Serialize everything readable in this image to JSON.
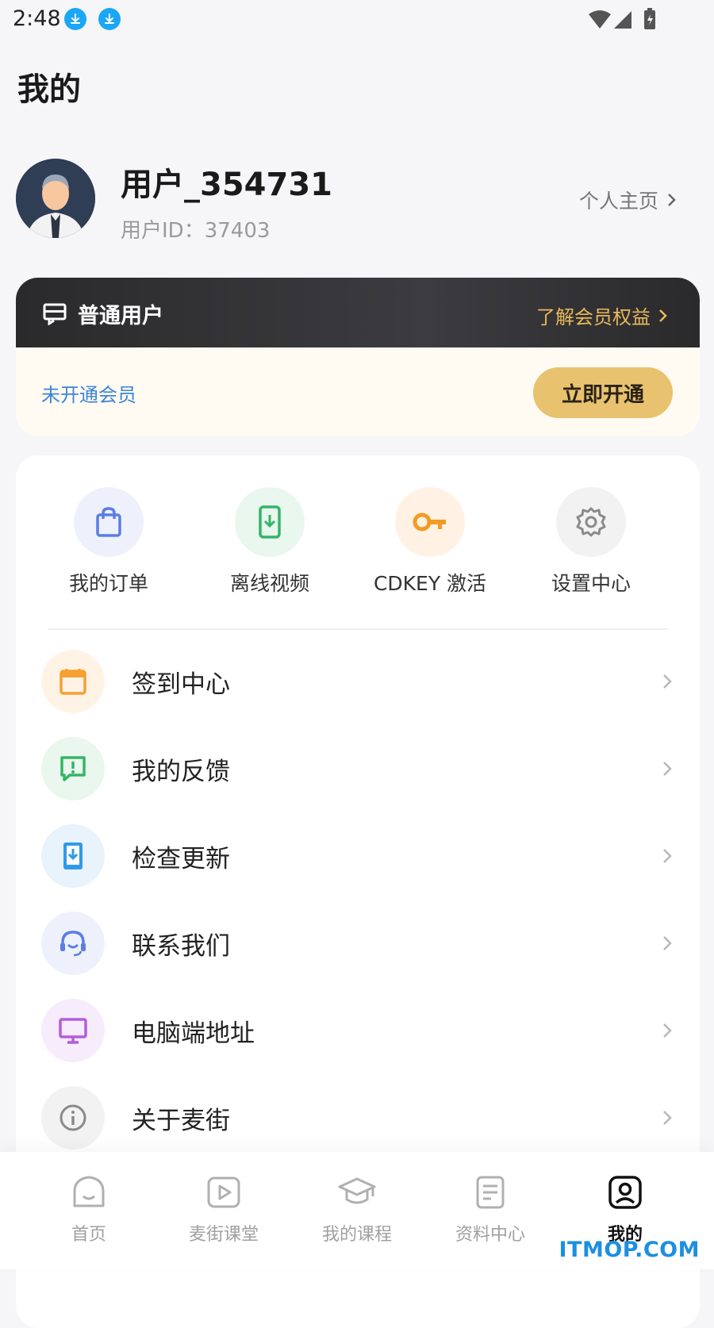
{
  "status_bar": {
    "time": "2:48"
  },
  "header": {
    "title": "我的"
  },
  "profile": {
    "username": "用户_354731",
    "user_id": "用户ID：37403",
    "home_link": "个人主页"
  },
  "membership": {
    "type": "普通用户",
    "benefits_link": "了解会员权益",
    "status": "未开通会员",
    "activate_label": "立即开通"
  },
  "quick_actions": [
    {
      "label": "我的订单",
      "icon": "shopping-bag-icon",
      "color": "#5b7ee5",
      "bg": "#eef1fc"
    },
    {
      "label": "离线视频",
      "icon": "phone-download-icon",
      "color": "#35b567",
      "bg": "#e9f7ee"
    },
    {
      "label": "CDKEY 激活",
      "icon": "key-icon",
      "color": "#f59a23",
      "bg": "#fff2e4"
    },
    {
      "label": "设置中心",
      "icon": "gear-icon",
      "color": "#8a8a8a",
      "bg": "#f2f2f2"
    }
  ],
  "menu": [
    {
      "label": "签到中心",
      "icon": "calendar-icon",
      "color": "#f5a030",
      "bg": "#fff3e6"
    },
    {
      "label": "我的反馈",
      "icon": "feedback-icon",
      "color": "#35b567",
      "bg": "#e9f7ee"
    },
    {
      "label": "检查更新",
      "icon": "update-icon",
      "color": "#2f9ae8",
      "bg": "#e8f3fc"
    },
    {
      "label": "联系我们",
      "icon": "headset-icon",
      "color": "#5b7ee5",
      "bg": "#eef1fc"
    },
    {
      "label": "电脑端地址",
      "icon": "monitor-icon",
      "color": "#b35ddb",
      "bg": "#f6ecfb"
    },
    {
      "label": "关于麦街",
      "icon": "info-icon",
      "color": "#8a8a8a",
      "bg": "#f2f2f2"
    }
  ],
  "bottom_nav": [
    {
      "label": "首页",
      "icon": "home-icon"
    },
    {
      "label": "麦街课堂",
      "icon": "video-play-icon"
    },
    {
      "label": "我的课程",
      "icon": "graduation-cap-icon"
    },
    {
      "label": "资料中心",
      "icon": "document-icon"
    },
    {
      "label": "我的",
      "icon": "user-icon",
      "active": true
    }
  ],
  "watermark": "ITMOP.COM"
}
